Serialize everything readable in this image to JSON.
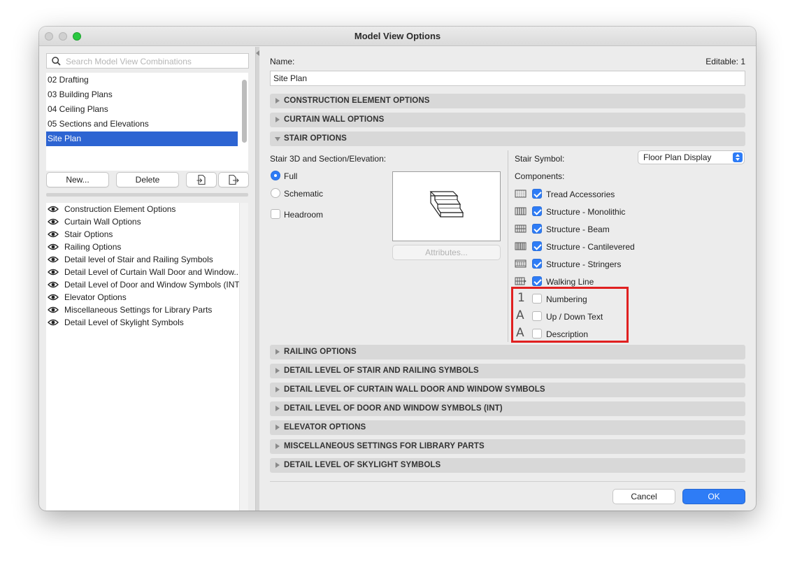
{
  "window": {
    "title": "Model View Options"
  },
  "left": {
    "search_placeholder": "Search Model View Combinations",
    "combinations": [
      {
        "label": "02 Drafting",
        "selected": false
      },
      {
        "label": "03 Building Plans",
        "selected": false
      },
      {
        "label": "04 Ceiling Plans",
        "selected": false
      },
      {
        "label": "05 Sections and Elevations",
        "selected": false
      },
      {
        "label": "Site Plan",
        "selected": true
      }
    ],
    "new_label": "New...",
    "delete_label": "Delete",
    "views": [
      "Construction Element Options",
      "Curtain Wall Options",
      "Stair Options",
      "Railing Options",
      "Detail level of Stair and Railing Symbols",
      "Detail Level of Curtain Wall Door and Window...",
      "Detail Level of Door and Window Symbols (INT)",
      "Elevator Options",
      "Miscellaneous Settings for Library Parts",
      "Detail Level of Skylight Symbols"
    ]
  },
  "right": {
    "name_label": "Name:",
    "editable_label": "Editable: 1",
    "name_value": "Site Plan",
    "sections_top": [
      {
        "label": "CONSTRUCTION ELEMENT OPTIONS",
        "expanded": false
      },
      {
        "label": "CURTAIN WALL OPTIONS",
        "expanded": false
      },
      {
        "label": "STAIR OPTIONS",
        "expanded": true
      }
    ],
    "stair": {
      "mode_label": "Stair 3D and Section/Elevation:",
      "full_label": "Full",
      "schematic_label": "Schematic",
      "headroom_label": "Headroom",
      "attributes_label": "Attributes...",
      "symbol_label": "Stair Symbol:",
      "symbol_value": "Floor Plan Display",
      "components_label": "Components:",
      "components": [
        {
          "label": "Tread Accessories",
          "checked": true,
          "icon": "tread-accessories-icon"
        },
        {
          "label": "Structure - Monolithic",
          "checked": true,
          "icon": "structure-monolithic-icon"
        },
        {
          "label": "Structure - Beam",
          "checked": true,
          "icon": "structure-beam-icon"
        },
        {
          "label": "Structure - Cantilevered",
          "checked": true,
          "icon": "structure-cantilevered-icon"
        },
        {
          "label": "Structure - Stringers",
          "checked": true,
          "icon": "structure-stringers-icon"
        },
        {
          "label": "Walking Line",
          "checked": true,
          "icon": "walking-line-icon"
        },
        {
          "label": "Numbering",
          "checked": false,
          "icon": "numbering-icon"
        },
        {
          "label": "Up / Down Text",
          "checked": false,
          "icon": "text-icon"
        },
        {
          "label": "Description",
          "checked": false,
          "icon": "text-icon"
        }
      ],
      "icon_glyphs": {
        "numbering": "1",
        "text": "A"
      }
    },
    "sections_bottom": [
      "RAILING OPTIONS",
      "DETAIL LEVEL OF STAIR AND RAILING SYMBOLS",
      "DETAIL LEVEL OF CURTAIN WALL DOOR AND WINDOW SYMBOLS",
      "DETAIL LEVEL OF DOOR AND WINDOW SYMBOLS (INT)",
      "ELEVATOR OPTIONS",
      "MISCELLANEOUS SETTINGS FOR LIBRARY PARTS",
      "DETAIL LEVEL OF SKYLIGHT SYMBOLS"
    ],
    "cancel_label": "Cancel",
    "ok_label": "OK"
  },
  "colors": {
    "accent": "#2e7cf6",
    "selection": "#2d64d2",
    "highlight": "#e02020"
  }
}
